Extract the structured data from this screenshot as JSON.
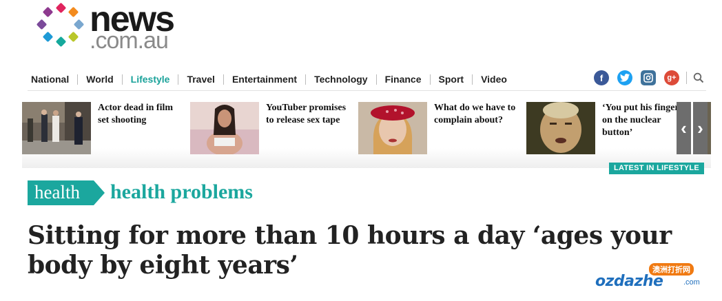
{
  "logo": {
    "word": "news",
    "sub": ".com.au"
  },
  "nav": {
    "items": [
      "National",
      "World",
      "Lifestyle",
      "Travel",
      "Entertainment",
      "Technology",
      "Finance",
      "Sport",
      "Video"
    ],
    "active": "Lifestyle"
  },
  "social": {
    "icons": [
      "facebook-icon",
      "twitter-icon",
      "instagram-icon",
      "google-plus-icon",
      "search-icon"
    ]
  },
  "carousel": {
    "cards": [
      {
        "title": "Actor dead in film set shooting"
      },
      {
        "title": "YouTuber promises to release sex tape"
      },
      {
        "title": "What do we have to complain about?"
      },
      {
        "title": "‘You put his finger on the nuclear button’"
      }
    ],
    "prev": "‹",
    "next": "›",
    "badge": "LATEST IN LIFESTYLE"
  },
  "tags": {
    "primary": "health",
    "secondary": "health problems"
  },
  "article": {
    "headline": "Sitting for more than 10 hours a day ‘ages your body by eight years’"
  },
  "watermark": {
    "top": "澳洲打折网",
    "main": "ozdazhe",
    "domain": ".com"
  },
  "colors": {
    "accent": "#1ba79e",
    "text": "#222222",
    "facebook": "#3b5998",
    "twitter": "#1da1f2",
    "instagram": "#3f729b",
    "gplus": "#dd4b39"
  }
}
